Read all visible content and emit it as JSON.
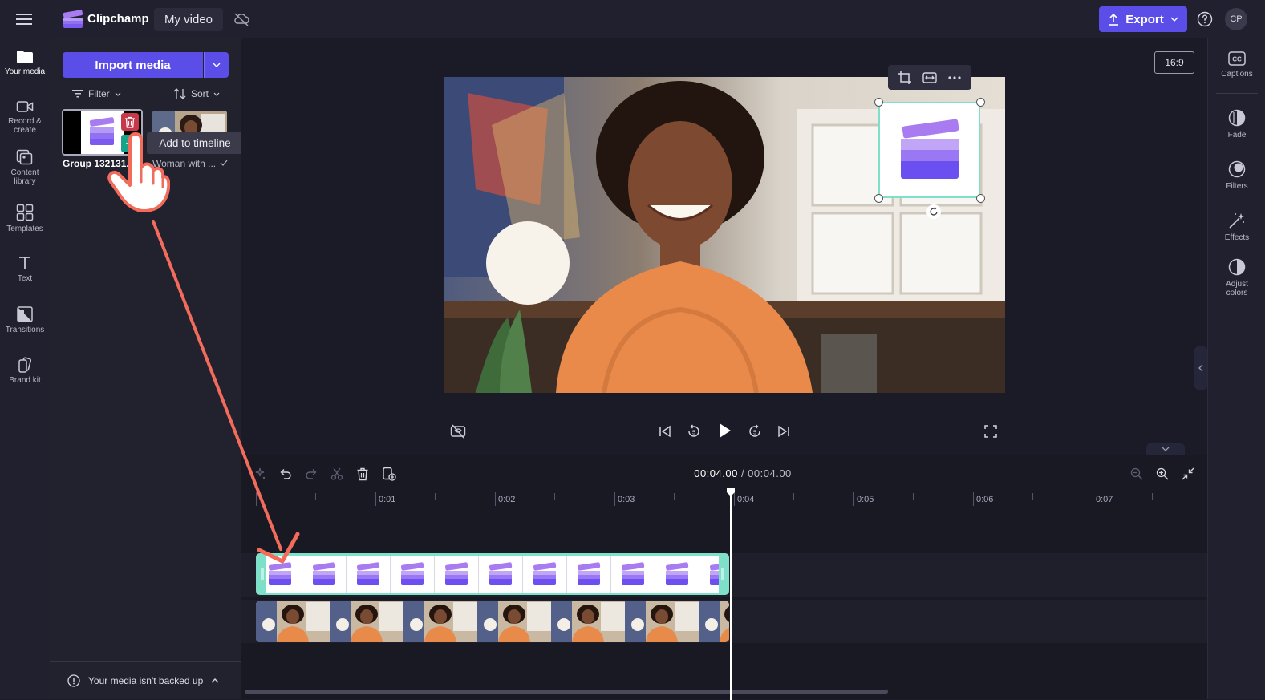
{
  "topbar": {
    "app_name": "Clipchamp",
    "project_name": "My video",
    "export_label": "Export",
    "avatar_initials": "CP"
  },
  "left_nav": {
    "items": [
      {
        "label": "Your media",
        "icon": "folder-icon",
        "active": true
      },
      {
        "label": "Record & create",
        "icon": "camera-icon"
      },
      {
        "label": "Content library",
        "icon": "library-icon"
      },
      {
        "label": "Templates",
        "icon": "templates-icon"
      },
      {
        "label": "Text",
        "icon": "text-icon"
      },
      {
        "label": "Transitions",
        "icon": "transitions-icon"
      },
      {
        "label": "Brand kit",
        "icon": "brand-kit-icon"
      }
    ]
  },
  "media_panel": {
    "import_label": "Import media",
    "filter_label": "Filter",
    "sort_label": "Sort",
    "items": [
      {
        "name": "Group 132131...",
        "selected": true
      },
      {
        "name": "Woman with ..."
      }
    ],
    "tooltip": "Add to timeline",
    "backup_message": "Your media isn't backed up"
  },
  "stage": {
    "aspect_ratio": "16:9"
  },
  "right_panel": {
    "items": [
      {
        "label": "Captions",
        "icon": "captions-icon"
      },
      {
        "label": "Fade",
        "icon": "fade-icon"
      },
      {
        "label": "Filters",
        "icon": "filters-icon"
      },
      {
        "label": "Effects",
        "icon": "effects-icon"
      },
      {
        "label": "Adjust colors",
        "icon": "adjust-colors-icon"
      }
    ]
  },
  "timeline": {
    "current_time": "00:04.00",
    "total_time": "/ 00:04.00",
    "ticks": [
      "0:01",
      "0:02",
      "0:03",
      "0:04",
      "0:05",
      "0:06",
      "0:07"
    ]
  },
  "colors": {
    "accent": "#5b4de8",
    "selection": "#7ee0c9",
    "delete": "#c6394a",
    "add": "#16a38a",
    "annotation": "#f26b5b"
  }
}
